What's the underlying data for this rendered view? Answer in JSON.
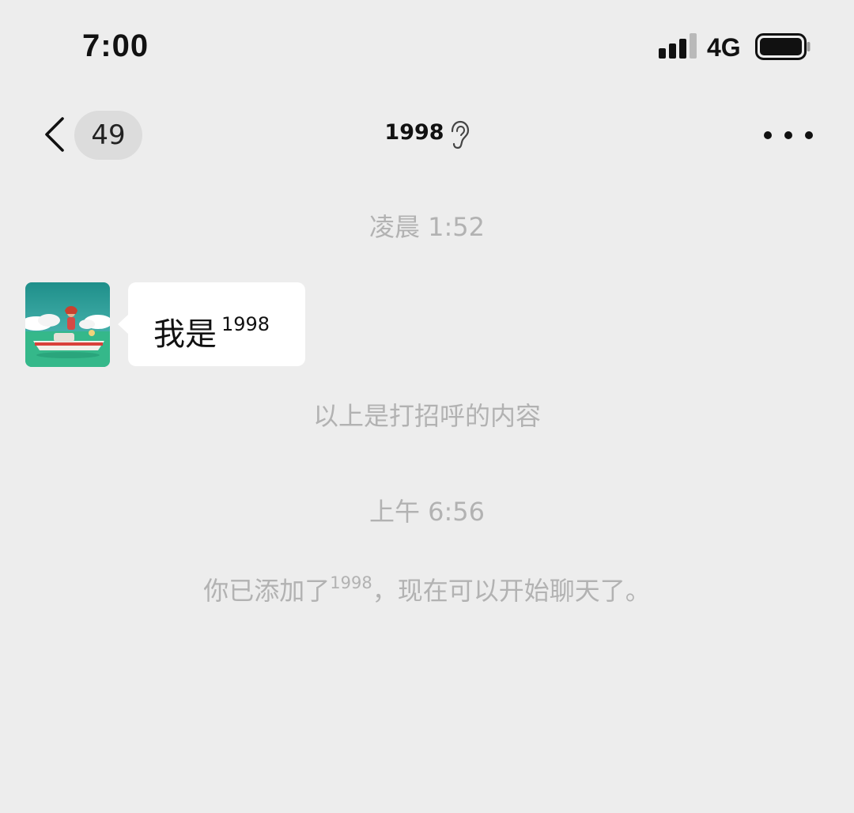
{
  "status_bar": {
    "time": "7:00",
    "network": "4G",
    "signal_bars_active": 3,
    "signal_bars_total": 4,
    "battery_level": 0.95
  },
  "nav": {
    "unread_count": "49",
    "title": "1998",
    "back_icon": "chevron-left-icon",
    "title_icon": "ear-icon",
    "more_icon": "more-dots-icon"
  },
  "messages": [
    {
      "timestamp": "凌晨 1:52",
      "sender_side": "left",
      "text": "我是",
      "text_sup": "1998"
    }
  ],
  "greeting_notice": "以上是打招呼的内容",
  "second_timestamp": "上午 6:56",
  "added_notice": {
    "prefix": "你已添加了",
    "name": "1998",
    "suffix": "，现在可以开始聊天了。"
  },
  "colors": {
    "background": "#ededed",
    "bubble": "#ffffff",
    "system_text": "#b2b2b2",
    "badge_bg": "#dcdcdc"
  }
}
